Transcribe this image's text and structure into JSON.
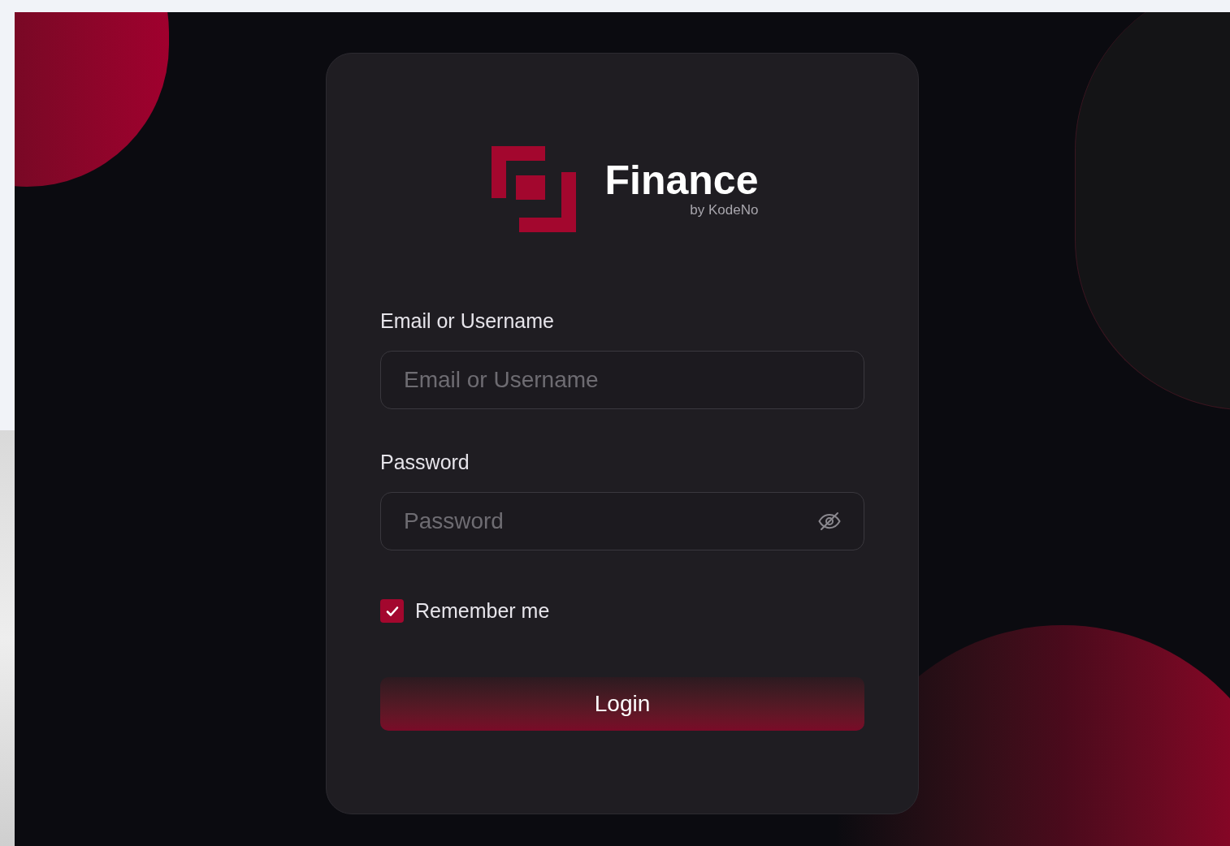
{
  "brand": {
    "name": "Finance",
    "tagline": "by KodeNo"
  },
  "fields": [
    {
      "label": "Email or Username",
      "placeholder": "Email or Username",
      "kind": "text"
    },
    {
      "label": "Password",
      "placeholder": "Password",
      "kind": "password"
    }
  ],
  "remember": {
    "label": "Remember me",
    "checked": true
  },
  "login_button": "Login"
}
